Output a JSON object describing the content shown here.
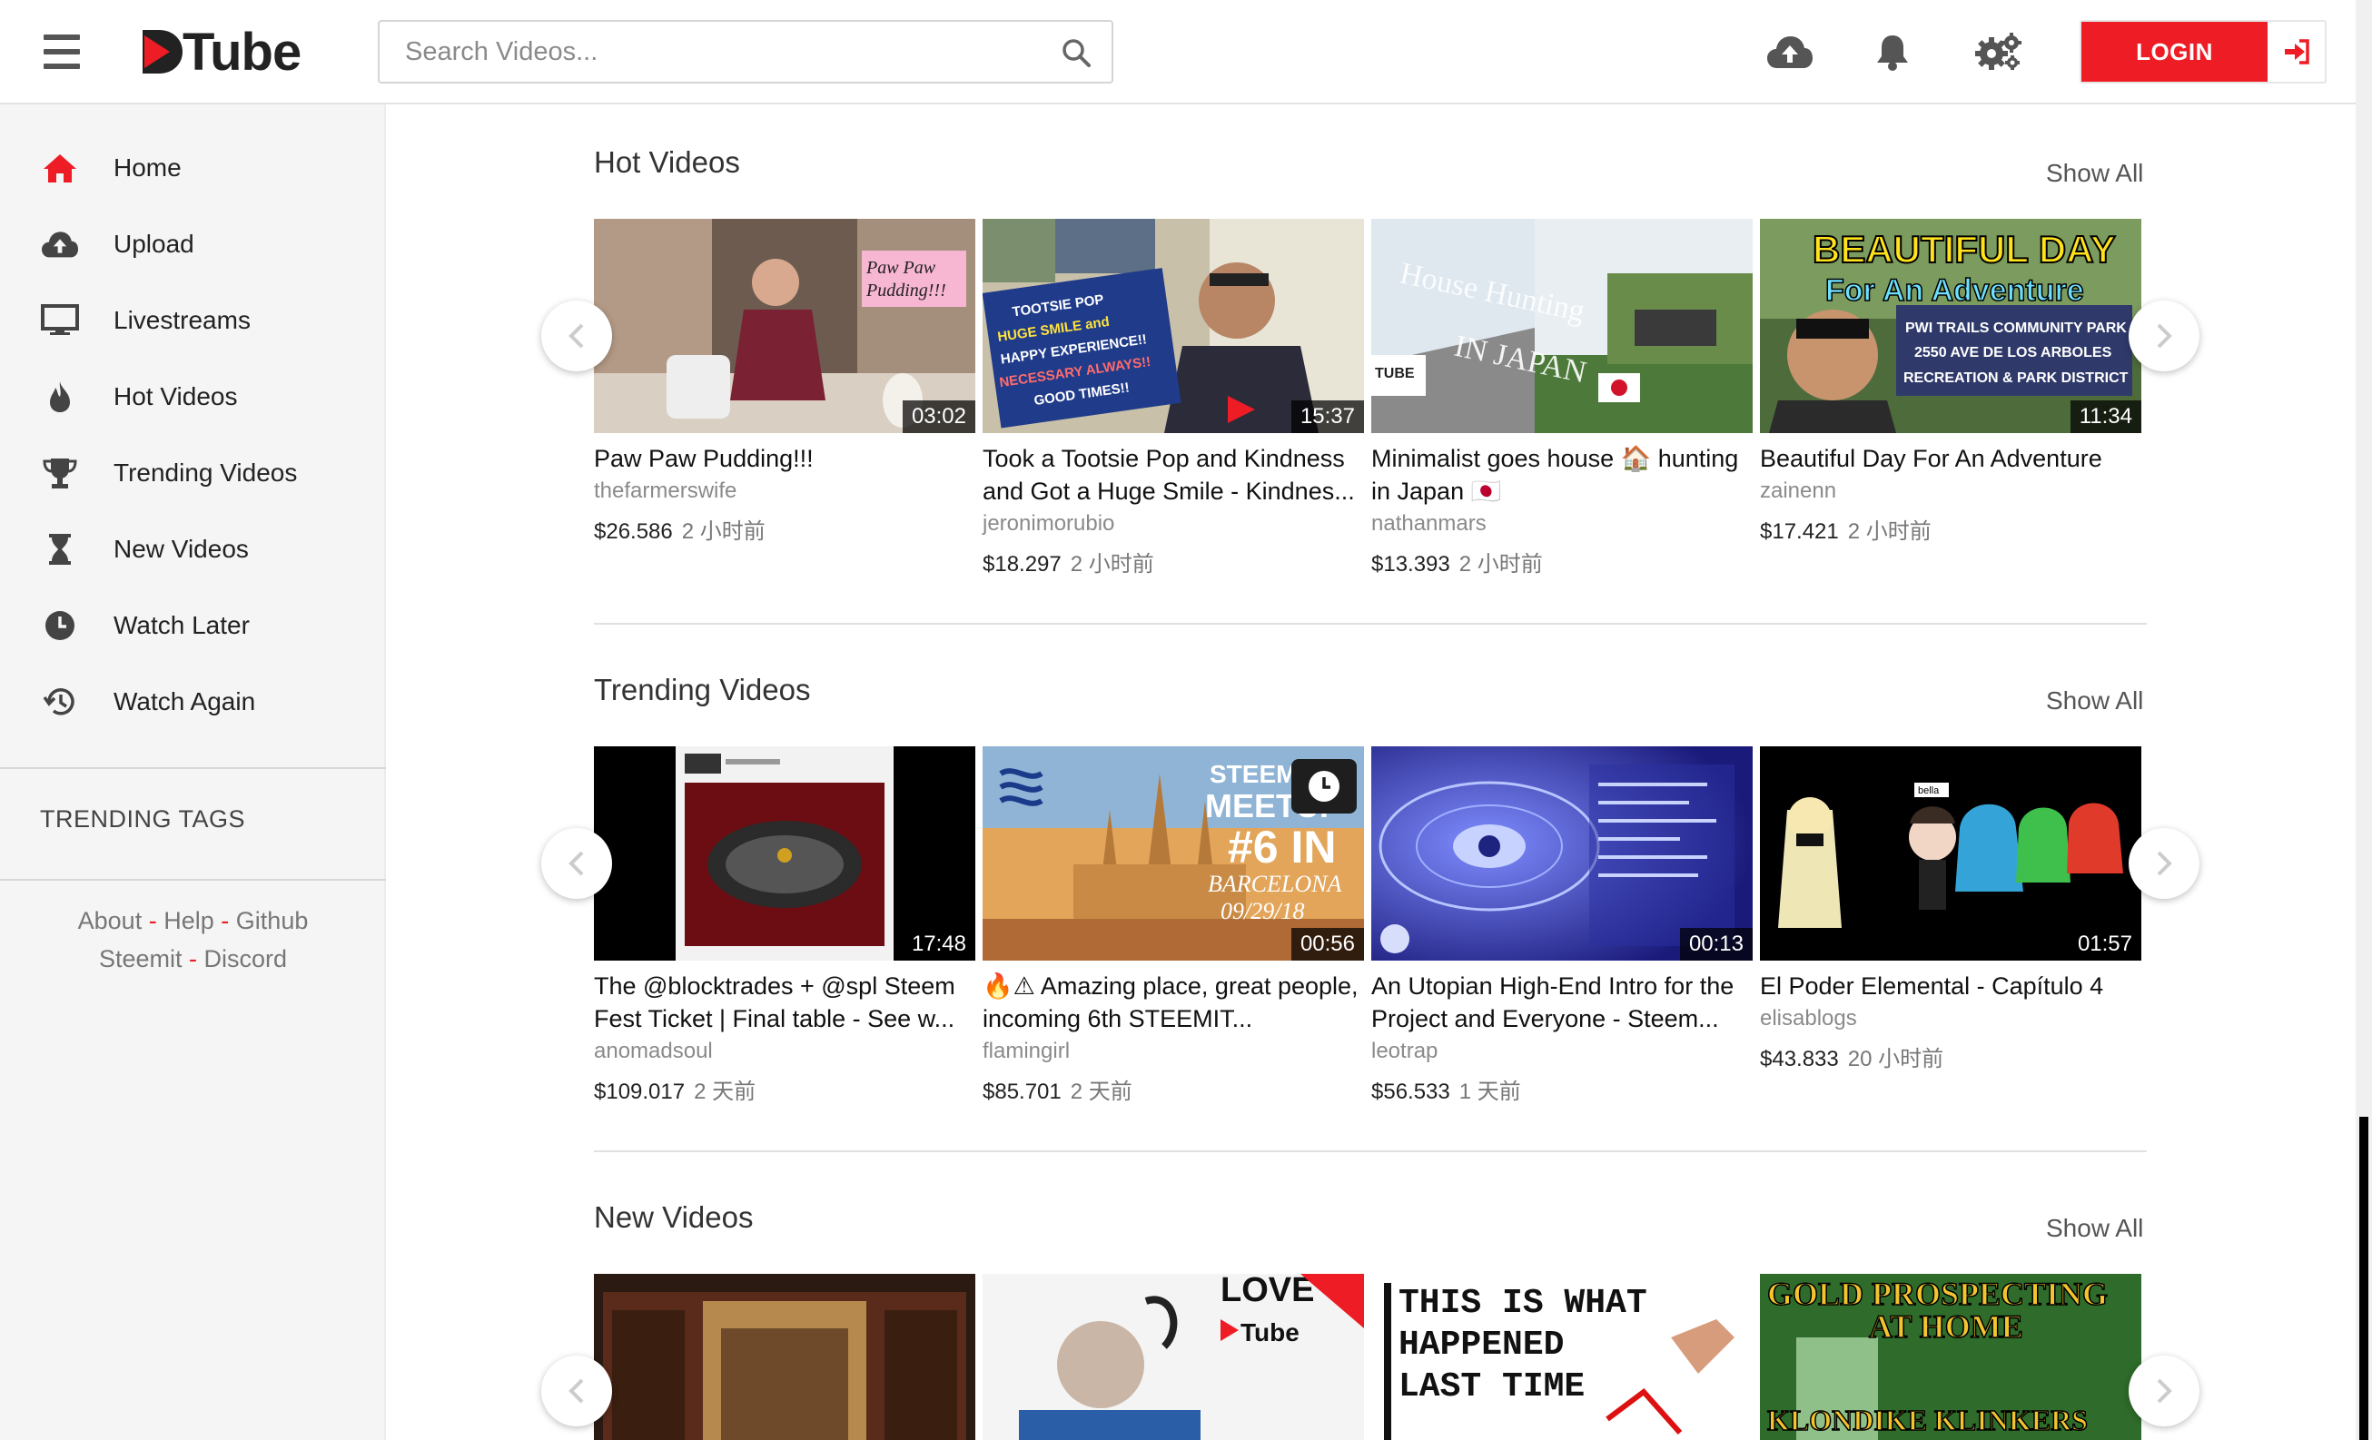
{
  "header": {
    "logo_text": "Tube",
    "search_placeholder": "Search Videos...",
    "login_label": "LOGIN",
    "accent": "#ee1c24"
  },
  "sidebar": {
    "items": [
      {
        "label": "Home",
        "icon": "home-icon"
      },
      {
        "label": "Upload",
        "icon": "cloud-upload-icon"
      },
      {
        "label": "Livestreams",
        "icon": "monitor-icon"
      },
      {
        "label": "Hot Videos",
        "icon": "flame-icon"
      },
      {
        "label": "Trending Videos",
        "icon": "trophy-icon"
      },
      {
        "label": "New Videos",
        "icon": "hourglass-icon"
      },
      {
        "label": "Watch Later",
        "icon": "clock-icon"
      },
      {
        "label": "Watch Again",
        "icon": "history-icon"
      }
    ],
    "trending_tags_heading": "TRENDING TAGS",
    "footer_links": [
      "About",
      "Help",
      "Github",
      "Steemit",
      "Discord"
    ],
    "footer_sep": "-"
  },
  "sections": [
    {
      "title": "Hot Videos",
      "show_all": "Show All",
      "videos": [
        {
          "title": "Paw Paw Pudding!!!",
          "author": "thefarmerswife",
          "price": "$26.586",
          "ago": "2 小时前",
          "duration": "03:02"
        },
        {
          "title": "Took a Tootsie Pop and Kindness and Got a Huge Smile - Kindnes...",
          "author": "jeronimorubio",
          "price": "$18.297",
          "ago": "2 小时前",
          "duration": "15:37"
        },
        {
          "title": "Minimalist goes house 🏠 hunting in Japan 🇯🇵",
          "author": "nathanmars",
          "price": "$13.393",
          "ago": "2 小时前",
          "duration": ""
        },
        {
          "title": "Beautiful Day For An Adventure",
          "author": "zainenn",
          "price": "$17.421",
          "ago": "2 小时前",
          "duration": "11:34"
        }
      ]
    },
    {
      "title": "Trending Videos",
      "show_all": "Show All",
      "videos": [
        {
          "title": "The @blocktrades + @spl Steem Fest Ticket | Final table - See w...",
          "author": "anomadsoul",
          "price": "$109.017",
          "ago": "2 天前",
          "duration": "17:48"
        },
        {
          "title": "🔥⚠ Amazing place, great people, incoming 6th STEEMIT...",
          "author": "flamingirl",
          "price": "$85.701",
          "ago": "2 天前",
          "duration": "00:56"
        },
        {
          "title": "An Utopian High-End Intro for the Project and Everyone - Steem...",
          "author": "leotrap",
          "price": "$56.533",
          "ago": "1 天前",
          "duration": "00:13"
        },
        {
          "title": "El Poder Elemental - Capítulo 4",
          "author": "elisablogs",
          "price": "$43.833",
          "ago": "20 小时前",
          "duration": "01:57"
        }
      ]
    },
    {
      "title": "New Videos",
      "show_all": "Show All",
      "thumb_texts": [
        "LOVE",
        "Tube",
        "THIS IS WHAT",
        "HAPPENED",
        "LAST TIME",
        "GOLD PROSPECTING",
        "AT HOME",
        "KLONDIKE KLINKERS"
      ]
    }
  ],
  "thumb_texts": {
    "hot_0": [
      "Paw Paw",
      "Pudding!!!"
    ],
    "hot_1": [
      "TOOTSIE POP",
      "HUGE SMILE and",
      "HAPPY EXPERIENCE!!",
      "NECESSARY ALWAYS!!",
      "GOOD TIMES!!"
    ],
    "hot_2": [
      "House Hunting",
      "IN JAPAN",
      "TUBE"
    ],
    "hot_3": [
      "BEAUTIFUL DAY",
      "For An Adventure",
      "PWI TRAILS COMMUNITY PARK",
      "2550 AVE DE LOS ARBOLES",
      "RECREATION & PARK DISTRICT"
    ],
    "tr_1": [
      "STEEMIT",
      "MEETUP",
      "#6 IN",
      "BARCELONA",
      "09/29/18"
    ],
    "tr_3": [
      "bella"
    ]
  }
}
